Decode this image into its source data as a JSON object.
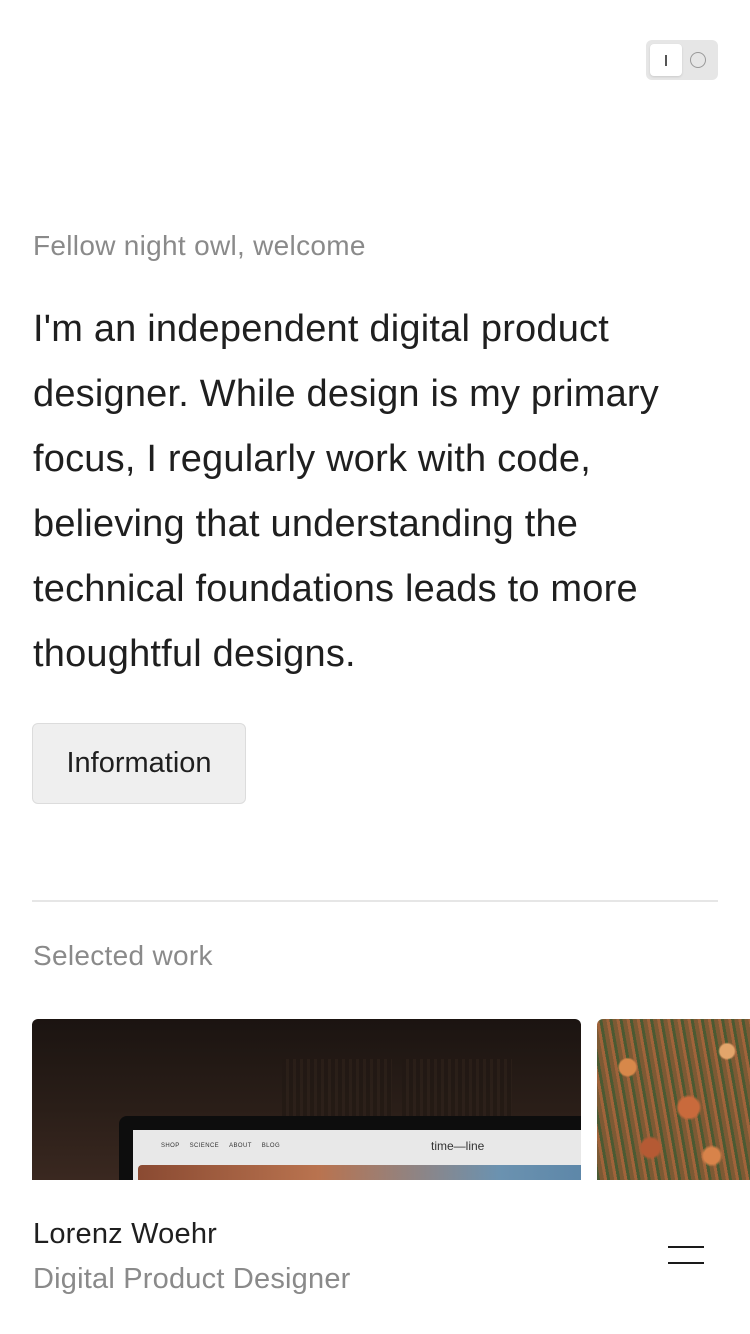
{
  "theme_toggle": {
    "knob_icon": "bar-icon",
    "off_icon": "circle-icon"
  },
  "intro": {
    "greeting": "Fellow night owl, welcome",
    "bio": "I'm an independent digital product designer. While design is my primary focus, I regularly work with code, believing that understanding the technical foundations leads to more thoughtful designs.",
    "info_button": "Information"
  },
  "work": {
    "label": "Selected work",
    "cards": [
      {
        "site_nav": [
          "SHOP",
          "SCIENCE",
          "ABOUT",
          "BLOG"
        ],
        "site_title": "time—line"
      },
      {}
    ]
  },
  "footer": {
    "name": "Lorenz Woehr",
    "role": "Digital Product Designer",
    "menu_icon": "hamburger-icon"
  }
}
